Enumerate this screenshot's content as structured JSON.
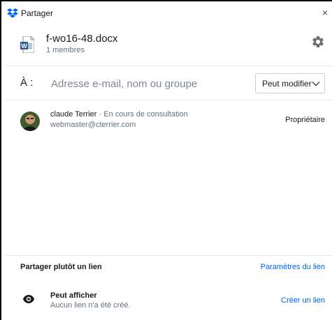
{
  "window": {
    "title": "Partager",
    "close_glyph": "×"
  },
  "file": {
    "name": "f-wo16-48.docx",
    "members": "1 membres",
    "icon": "word-document-icon"
  },
  "to": {
    "label": "À :",
    "placeholder": "Adresse e-mail, nom ou groupe",
    "permission": "Peut modifier"
  },
  "members": [
    {
      "name": "claude Terrier",
      "separator": " · ",
      "status": "En cours de consultation",
      "email": "webmaster@cterrier.com",
      "role": "Propriétaire"
    }
  ],
  "link": {
    "title": "Partager plutôt un lien",
    "settings_label": "Paramètres du lien",
    "permission": "Peut afficher",
    "status": "Aucun lien n'a été créé.",
    "create_label": "Créer un lien"
  },
  "colors": {
    "accent": "#0061fe",
    "word_blue": "#2b579a",
    "dropbox_blue": "#0061fe"
  }
}
